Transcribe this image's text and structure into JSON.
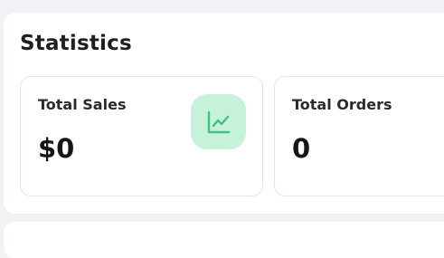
{
  "statistics": {
    "title": "Statistics",
    "cards": [
      {
        "label": "Total Sales",
        "value": "$0",
        "icon": "line-chart-icon",
        "icon_bg": "#c7f2da",
        "icon_color": "#3fc47f"
      },
      {
        "label": "Total Orders",
        "value": "0"
      }
    ]
  }
}
